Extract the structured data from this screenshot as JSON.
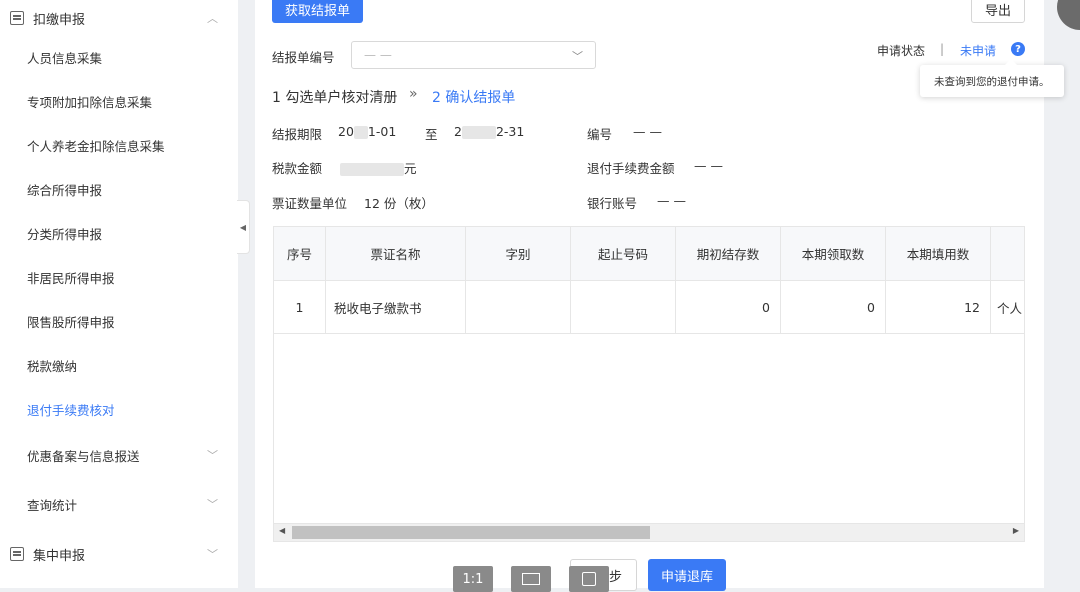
{
  "sidebar": {
    "section1": "扣缴申报",
    "items": [
      "人员信息采集",
      "专项附加扣除信息采集",
      "个人养老金扣除信息采集",
      "综合所得申报",
      "分类所得申报",
      "非居民所得申报",
      "限售股所得申报",
      "税款缴纳",
      "退付手续费核对"
    ],
    "active_item": "退付手续费核对",
    "collapsible": [
      "优惠备案与信息报送",
      "查询统计"
    ],
    "section2": "集中申报"
  },
  "toolbar": {
    "fetch_button": "获取结报单",
    "export_button": "导出"
  },
  "form": {
    "report_no_label": "结报单编号",
    "report_no_placeholder": "— —",
    "status_label": "申请状态",
    "status_sep": "|",
    "status_value": "未申请",
    "tooltip": "未查询到您的退付申请。"
  },
  "steps": {
    "step1": "1 勾选单户核对清册",
    "arrow": "»",
    "step2": "2 确认结报单"
  },
  "info": {
    "period_label": "结报期限",
    "period_start_a": "20",
    "period_start_b": "1-01",
    "period_to": "至",
    "period_end_a": "2",
    "period_end_b": "2-31",
    "tax_amount_label": "税款金额",
    "tax_amount_unit": "元",
    "ticket_unit_label": "票证数量单位",
    "ticket_unit_value": "12 份（枚）",
    "number_label": "编号",
    "number_value": "— —",
    "refund_fee_label": "退付手续费金额",
    "refund_fee_value": "— —",
    "bank_account_label": "银行账号",
    "bank_account_value": "— —"
  },
  "table": {
    "headers": [
      "序号",
      "票证名称",
      "字别",
      "起止号码",
      "期初结存数",
      "本期领取数",
      "本期填用数",
      ""
    ],
    "rows": [
      [
        "1",
        "税收电子缴款书",
        "",
        "",
        "0",
        "0",
        "12",
        "个人"
      ]
    ]
  },
  "bottom": {
    "tool_1": "1:1",
    "next_step_partial": "步",
    "apply_button": "申请退库"
  },
  "colors": {
    "accent": "#3a7af5",
    "sidebar_bg": "#ffffff",
    "page_bg": "#eef0f3"
  }
}
